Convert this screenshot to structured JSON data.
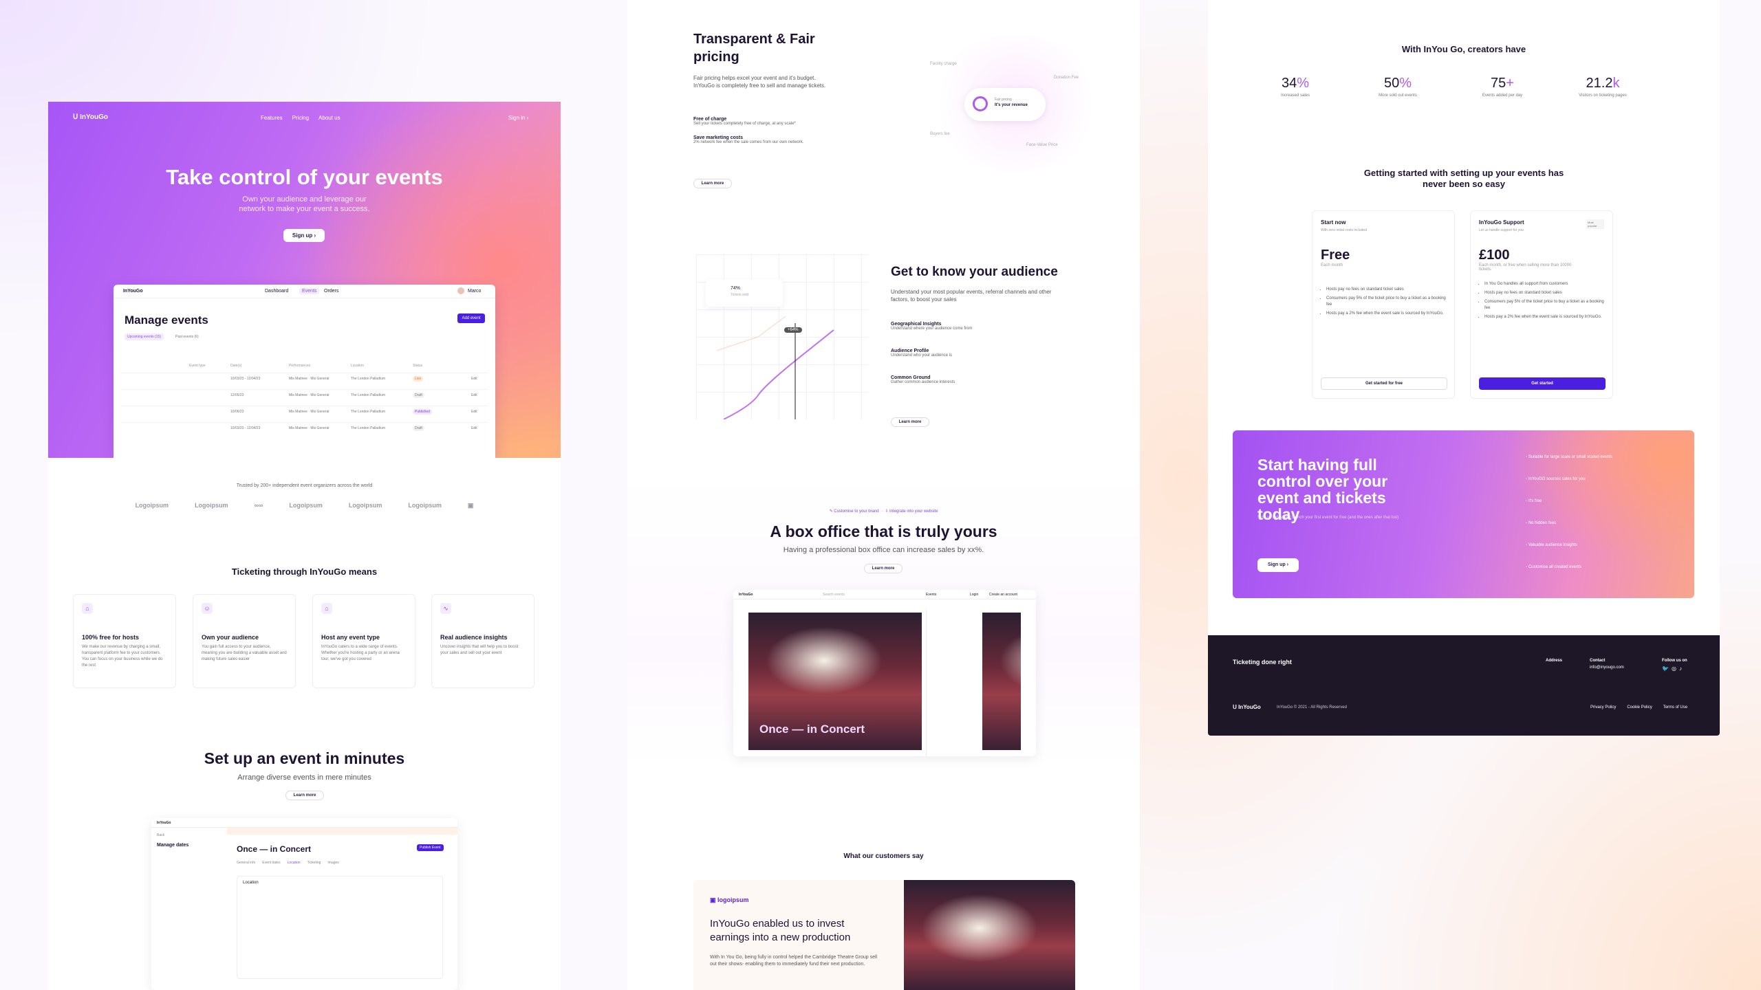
{
  "col1": {
    "nav": {
      "logo": "InYouGo",
      "links": [
        "Features",
        "Pricing",
        "About us"
      ],
      "sign_in": "Sign in"
    },
    "hero": {
      "title": "Take control of your events",
      "subtitle": "Own your audience and leverage our network to make your event a success.",
      "cta": "Sign up"
    },
    "dashboard": {
      "brand": "InYouGo",
      "tabs": [
        "Dashboard",
        "Events",
        "Orders"
      ],
      "user": "Marco",
      "title": "Manage events",
      "add": "Add event",
      "filters": [
        "Upcoming events (15)",
        "Past events (6)"
      ],
      "columns": [
        "Event type",
        "Date(s)",
        "Performances",
        "Location",
        "Status"
      ],
      "rows": [
        {
          "date": "10/03/23 - 12/04/23",
          "perf": "Mis Matinee · Mis General",
          "loc": "The London Palladium",
          "status": "Live"
        },
        {
          "date": "12/05/23",
          "perf": "Mis Matinee · Mis General",
          "loc": "The London Palladium",
          "status": "Draft"
        },
        {
          "date": "10/06/23",
          "perf": "Mis Matinee · Mis General",
          "loc": "The London Palladium",
          "status": "Published"
        },
        {
          "date": "10/03/23 - 12/04/23",
          "perf": "Mis Matinee · Mis General",
          "loc": "The London Palladium",
          "status": "Draft"
        }
      ],
      "edit": "Edit"
    },
    "trusted": "Trusted by 200+ independent event organizers across the world",
    "logos": [
      "Logoipsum",
      "Logoipsum",
      "∞∞",
      "Logoipsum",
      "Logoipsum",
      "Logoipsum",
      "▣"
    ],
    "features_title": "Ticketing through InYouGo means",
    "features": [
      {
        "icon": "tag-icon",
        "title": "100% free for hosts",
        "text": "We make our revenue by charging a small, transparent platform fee to your customers. You can focus on your business while we do the rest"
      },
      {
        "icon": "user-icon",
        "title": "Own your audience",
        "text": "You gain full access to your audience, meaning you are building a valuable asset and making future sales easier"
      },
      {
        "icon": "home-icon",
        "title": "Host any event type",
        "text": "InYouGo caters to a wide range of events. Whether you're hosting a party or an arena tour, we've got you covered"
      },
      {
        "icon": "activity-icon",
        "title": "Real audience insights",
        "text": "Uncover insights that will help you to boost your sales and sell out your event"
      }
    ],
    "setup": {
      "title": "Set up an event in minutes",
      "subtitle": "Arrange diverse events in mere minutes",
      "cta": "Learn more",
      "mock": {
        "brand": "InYouGo",
        "back": "Back",
        "side_title": "Manage dates",
        "event": "Once — in Concert",
        "publish": "Publish Event",
        "tabs": [
          "General info",
          "Event dates",
          "Location",
          "Ticketing",
          "Images"
        ],
        "section": "Location"
      }
    }
  },
  "col2": {
    "pricing": {
      "title": "Transparent & Fair pricing",
      "text": "Fair pricing helps excel your event and it's budget. InYouGo is completely free to sell and manage tickets.",
      "items": [
        {
          "title": "Free of charge",
          "text": "Sell your tickets completely free of charge, at any scale*"
        },
        {
          "title": "Save marketing costs",
          "text": "2% network fee when the sale comes from our own network."
        }
      ],
      "cta": "Learn more",
      "orbit": [
        "Facility charge",
        "Donation Fee",
        "Buyers fee",
        "Face-Value Price"
      ],
      "center_top": "Fair pricing",
      "center": "It's your revenue"
    },
    "audience": {
      "title": "Get to know your audience",
      "text": "Understand your most popular events, referral channels and other factors, to boost your sales",
      "items": [
        {
          "title": "Geographical Insights",
          "text": "Understand where your audience come from"
        },
        {
          "title": "Audience Profile",
          "text": "Understand who your audience is"
        },
        {
          "title": "Common Ground",
          "text": "Gather common audience interests"
        }
      ],
      "cta": "Learn more",
      "stat1": "74%",
      "stat1_label": "Tickets sold",
      "chip": "+64%"
    },
    "boxoffice": {
      "tags": [
        "Customise to your brand",
        "Integrate into your website"
      ],
      "title": "A box office that is truly yours",
      "subtitle": "Having a professional box office can increase sales by xx%.",
      "cta": "Learn more",
      "mock": {
        "brand": "InYouGo",
        "search": "Search events",
        "events": "Events",
        "login": "Login",
        "create": "Create an account",
        "show": "Once — in Concert"
      }
    },
    "testimonial": {
      "title": "What our customers say",
      "logo": "logoipsum",
      "quote": "InYouGo enabled us to invest earnings into a new production",
      "text": "With In You Go, being fully in control helped the Cambridge Theatre Group sell out their shows- enabling them to immediately fund their next production."
    }
  },
  "col3": {
    "stats_title": "With InYou Go, creators have",
    "stats": [
      {
        "num": "34",
        "suffix": "%",
        "label": "Increased sales"
      },
      {
        "num": "50",
        "suffix": "%",
        "label": "More sold out events"
      },
      {
        "num": "75",
        "suffix": "+",
        "label": "Events added per day"
      },
      {
        "num": "21.2",
        "suffix": "k",
        "label": "Visitors on ticketing pages"
      }
    ],
    "start_title": "Getting started with setting up your events has never been so easy",
    "plans": [
      {
        "name": "Start now",
        "note": "With zero initial costs included",
        "price": "Free",
        "period": "Each month",
        "items": [
          "Hosts pay no fees on standard ticket sales",
          "Consumers pay 5% of the ticket price to buy a ticket as a booking fee",
          "Hosts pay a 2% fee when the event sale is sourced by InYouGo."
        ],
        "cta": "Get started for free"
      },
      {
        "name": "InYouGo Support",
        "note": "Let us handle support for you",
        "badge": "Most popular",
        "price": "£100",
        "period": "Each month, or free when selling more than 10000 tickets.",
        "items": [
          "In You Go handles all support from customers",
          "Hosts pay no fees on standard ticket sales",
          "Consumers pay 5% of the ticket price to buy a ticket as a booking fee",
          "Hosts pay a 2% fee when the event sale is sourced by InYouGo."
        ],
        "cta": "Get started"
      }
    ],
    "cta": {
      "title": "Start having full control over your event and tickets today",
      "text": "Sign up today and launch your first event for free (and the ones after that too)",
      "button": "Sign up",
      "list": [
        "Suitable for large scale or small scaled events",
        "InYouGO sources sales for you",
        "It's free",
        "No hidden fees",
        "Valuable audience insights",
        "Customise all created events"
      ]
    },
    "footer": {
      "tagline": "Ticketing done right",
      "address": "Address",
      "contact": "Contact",
      "email": "info@inyougo.com",
      "follow": "Follow us on",
      "logo": "InYouGo",
      "copyright": "InYouGo © 2021 - All Rights Reserved",
      "links": [
        "Privacy Policy",
        "Cookie Policy",
        "Terms of Use"
      ]
    }
  },
  "colors": {
    "accent": "#4b1fe0",
    "purple": "#a656f6",
    "peach": "#f7a08a",
    "dark": "#1d1727"
  }
}
